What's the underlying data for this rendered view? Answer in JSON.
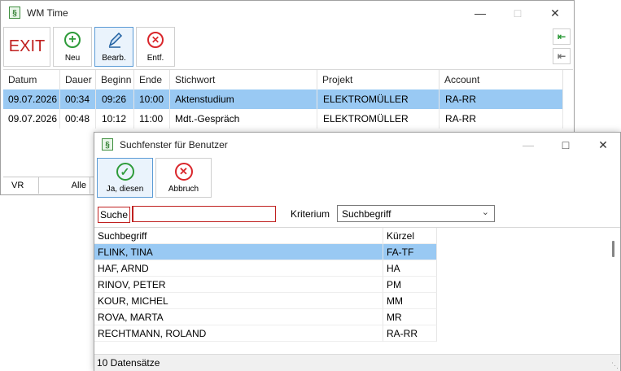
{
  "main_window": {
    "title": "WM Time",
    "exit_label": "EXIT",
    "toolbar": [
      {
        "label": "Neu"
      },
      {
        "label": "Bearb."
      },
      {
        "label": "Entf."
      }
    ],
    "columns": [
      "Datum",
      "Dauer",
      "Beginn",
      "Ende",
      "Stichwort",
      "Projekt",
      "Account"
    ],
    "rows": [
      {
        "datum": "09.07.2026",
        "dauer": "00:34",
        "beginn": "09:26",
        "ende": "10:00",
        "stichwort": "Aktenstudium",
        "projekt": "ELEKTROMÜLLER",
        "account": "RA-RR"
      },
      {
        "datum": "09.07.2026",
        "dauer": "00:48",
        "beginn": "10:12",
        "ende": "11:00",
        "stichwort": "Mdt.-Gespräch",
        "projekt": "ELEKTROMÜLLER",
        "account": "RA-RR"
      }
    ],
    "footer": {
      "left": "VR",
      "right": "Alle"
    }
  },
  "dialog": {
    "title": "Suchfenster für Benutzer",
    "buttons": [
      {
        "label": "Ja, diesen"
      },
      {
        "label": "Abbruch"
      }
    ],
    "search_label": "Suche",
    "search_value": "",
    "criterion_label": "Kriterium",
    "criterion_value": "Suchbegriff",
    "columns": [
      "Suchbegriff",
      "Kürzel"
    ],
    "rows": [
      {
        "name": "FLINK, TINA",
        "code": "FA-TF"
      },
      {
        "name": "HAF, ARND",
        "code": "HA"
      },
      {
        "name": "RINOV, PETER",
        "code": "PM"
      },
      {
        "name": "KOUR, MICHEL",
        "code": "MM"
      },
      {
        "name": "ROVA, MARTA",
        "code": "MR"
      },
      {
        "name": "RECHTMANN, ROLAND",
        "code": "RA-RR"
      }
    ],
    "status": "10 Datensätze"
  },
  "colors": {
    "selection": "#99c9f3",
    "accent": "#5b9bd5",
    "exit_red": "#c0201f",
    "ok_green": "#2e9b3a",
    "cancel_red": "#d9262b"
  }
}
